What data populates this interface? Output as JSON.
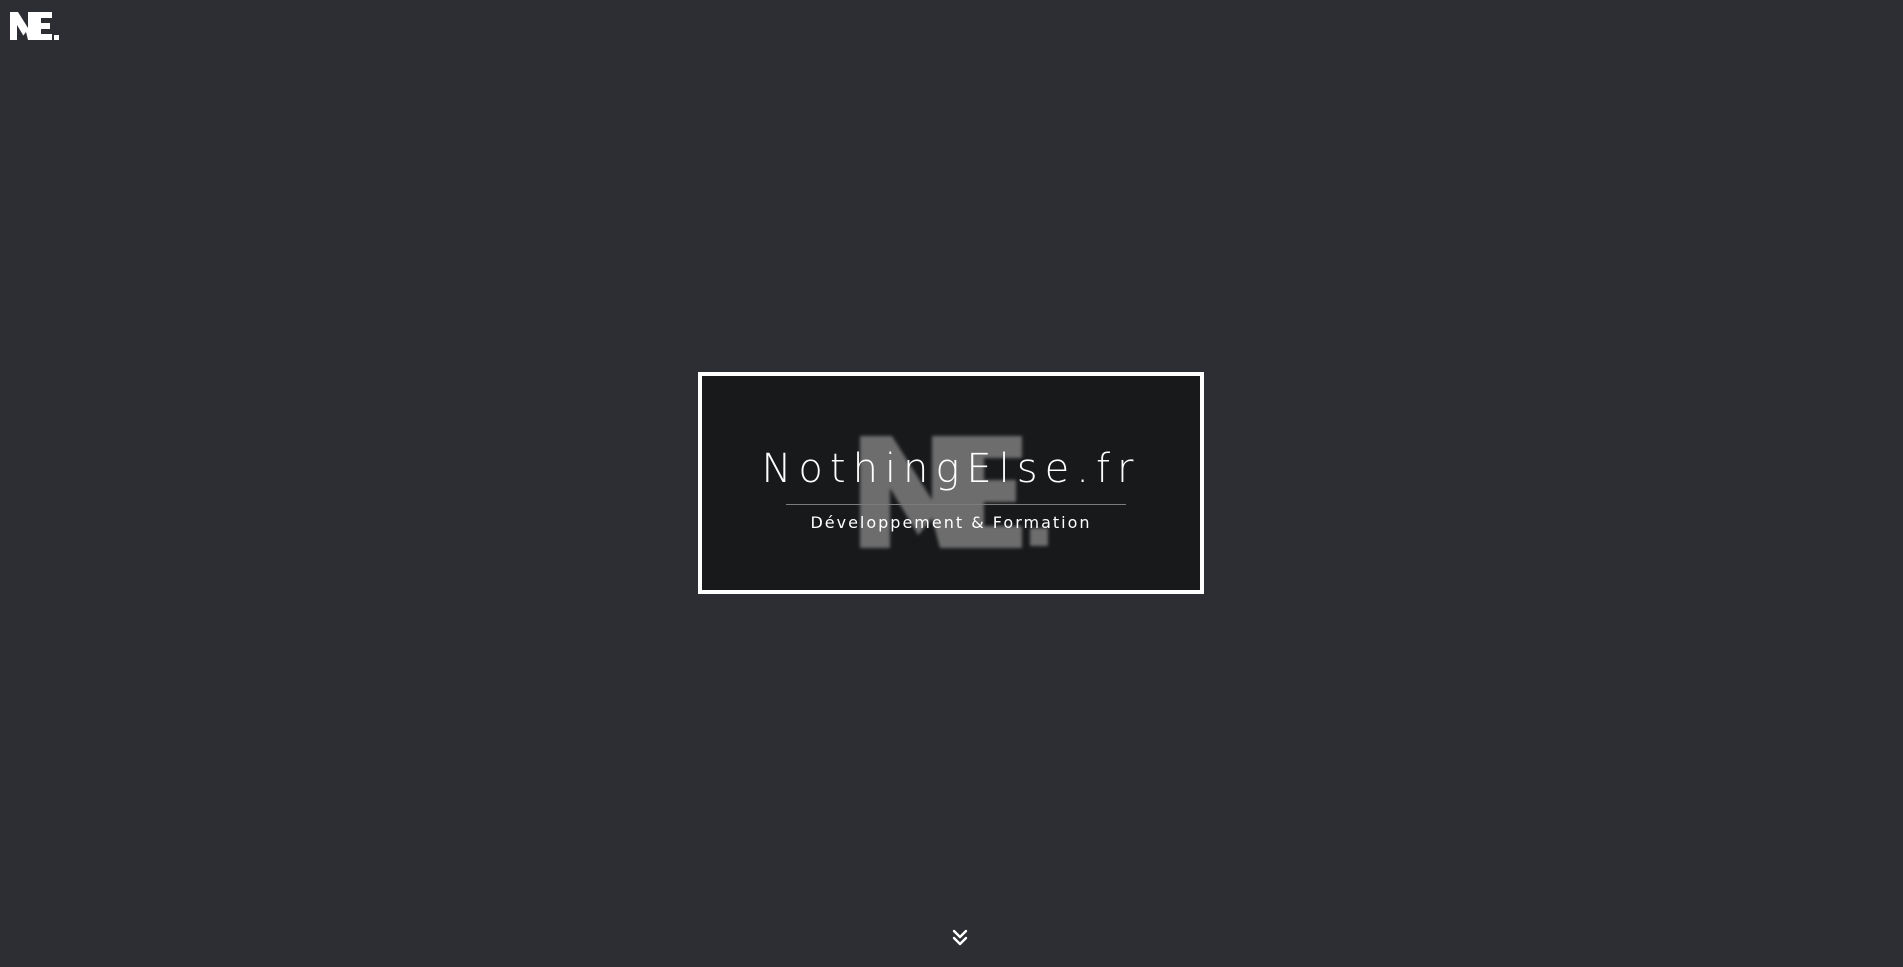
{
  "header": {
    "logo_text": "NE.",
    "logo_icon": "ne-logo-icon"
  },
  "hero": {
    "title": "NothingElse.fr",
    "subtitle": "Développement & Formation",
    "watermark_icon": "ne-watermark-logo"
  },
  "scroll_down": {
    "icon": "double-chevron-down-icon"
  },
  "colors": {
    "background": "#2d2e33",
    "hero_box_background": "#18191b",
    "hero_border": "#ffffff",
    "text": "#ffffff",
    "watermark": "#8a8a8a",
    "divider": "#7b7c80"
  }
}
